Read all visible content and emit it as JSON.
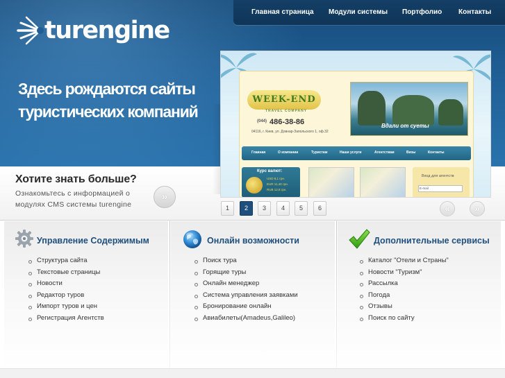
{
  "brand": {
    "logo_text": "turengine"
  },
  "hero": {
    "tagline_line1": "Здесь рождаются сайты",
    "tagline_line2": "туристических компаний"
  },
  "topnav": {
    "items": [
      {
        "label": "Главная страница"
      },
      {
        "label": "Модули системы"
      },
      {
        "label": "Портфолио"
      },
      {
        "label": "Контакты"
      }
    ]
  },
  "preview": {
    "brand": "WEEK-END",
    "brand_sub": "TRAVEL COMPANY",
    "phone_prefix": "(044)",
    "phone": "486-38-86",
    "address": "04116, г. Киев, ул. Довнар-Запольского 1, оф.32",
    "photo_caption": "Вдали от суеты",
    "menu": [
      "Главная",
      "О компании",
      "Туристам",
      "Наши услуги",
      "Агентствам",
      "Визы",
      "Контакты"
    ],
    "kurs_title": "Курс валют:",
    "kurs_rows": [
      "USD 8,1 грн.",
      "EUR 11,40 грн.",
      "RUB 12,8 грн."
    ],
    "login_title": "Вход для агентств",
    "login_email_placeholder": "E-mail"
  },
  "know_more": {
    "title": "Хотите знать больше?",
    "description": "Ознакомьтесь с информацией о модулях CMS системы turengine",
    "button_glyph": "»"
  },
  "pager": {
    "pages": [
      "1",
      "2",
      "3",
      "4",
      "5",
      "6"
    ],
    "active_page": "2",
    "prev_glyph": "«",
    "next_glyph": "»"
  },
  "columns": [
    {
      "title": "Управление Содержимым",
      "icon": "gear-icon",
      "items": [
        "Структура сайта",
        "Текстовые страницы",
        "Новости",
        "Редактор туров",
        "Импорт туров и цен",
        "Регистрация Агентств"
      ]
    },
    {
      "title": "Онлайн возможности",
      "icon": "globe-icon",
      "items": [
        "Поиск тура",
        "Горящие туры",
        "Онлайн менеджер",
        "Система управления заявками",
        "Бронирование онлайн",
        "Авиабилеты(Amadeus,Galileo)"
      ]
    },
    {
      "title": "Дополнительные сервисы",
      "icon": "checkmark-icon",
      "items": [
        "Каталог \"Отели и Страны\"",
        "Новости \"Туризм\"",
        "Рассылка",
        "Погода",
        "Отзывы",
        "Поиск по сайту"
      ]
    }
  ],
  "colors": {
    "header_blue": "#1f5f96",
    "nav_dark": "#0f3558",
    "title_blue": "#1f4f7c",
    "active_page": "#1f4f7c"
  }
}
